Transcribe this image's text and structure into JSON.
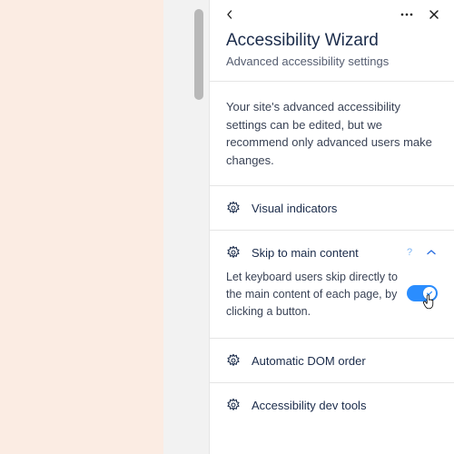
{
  "header": {
    "title": "Accessibility Wizard",
    "subtitle": "Advanced accessibility settings"
  },
  "info": "Your site's advanced accessibility settings can be edited, but we recommend only advanced users make changes.",
  "sections": {
    "visual": {
      "label": "Visual indicators"
    },
    "skip": {
      "label": "Skip to main content",
      "desc": "Let keyboard users skip directly to the main content of each page, by clicking a button.",
      "toggle_on": true
    },
    "dom": {
      "label": "Automatic DOM order"
    },
    "dev": {
      "label": "Accessibility dev tools"
    }
  },
  "help_glyph": "?",
  "colors": {
    "accent": "#2a8dff"
  }
}
